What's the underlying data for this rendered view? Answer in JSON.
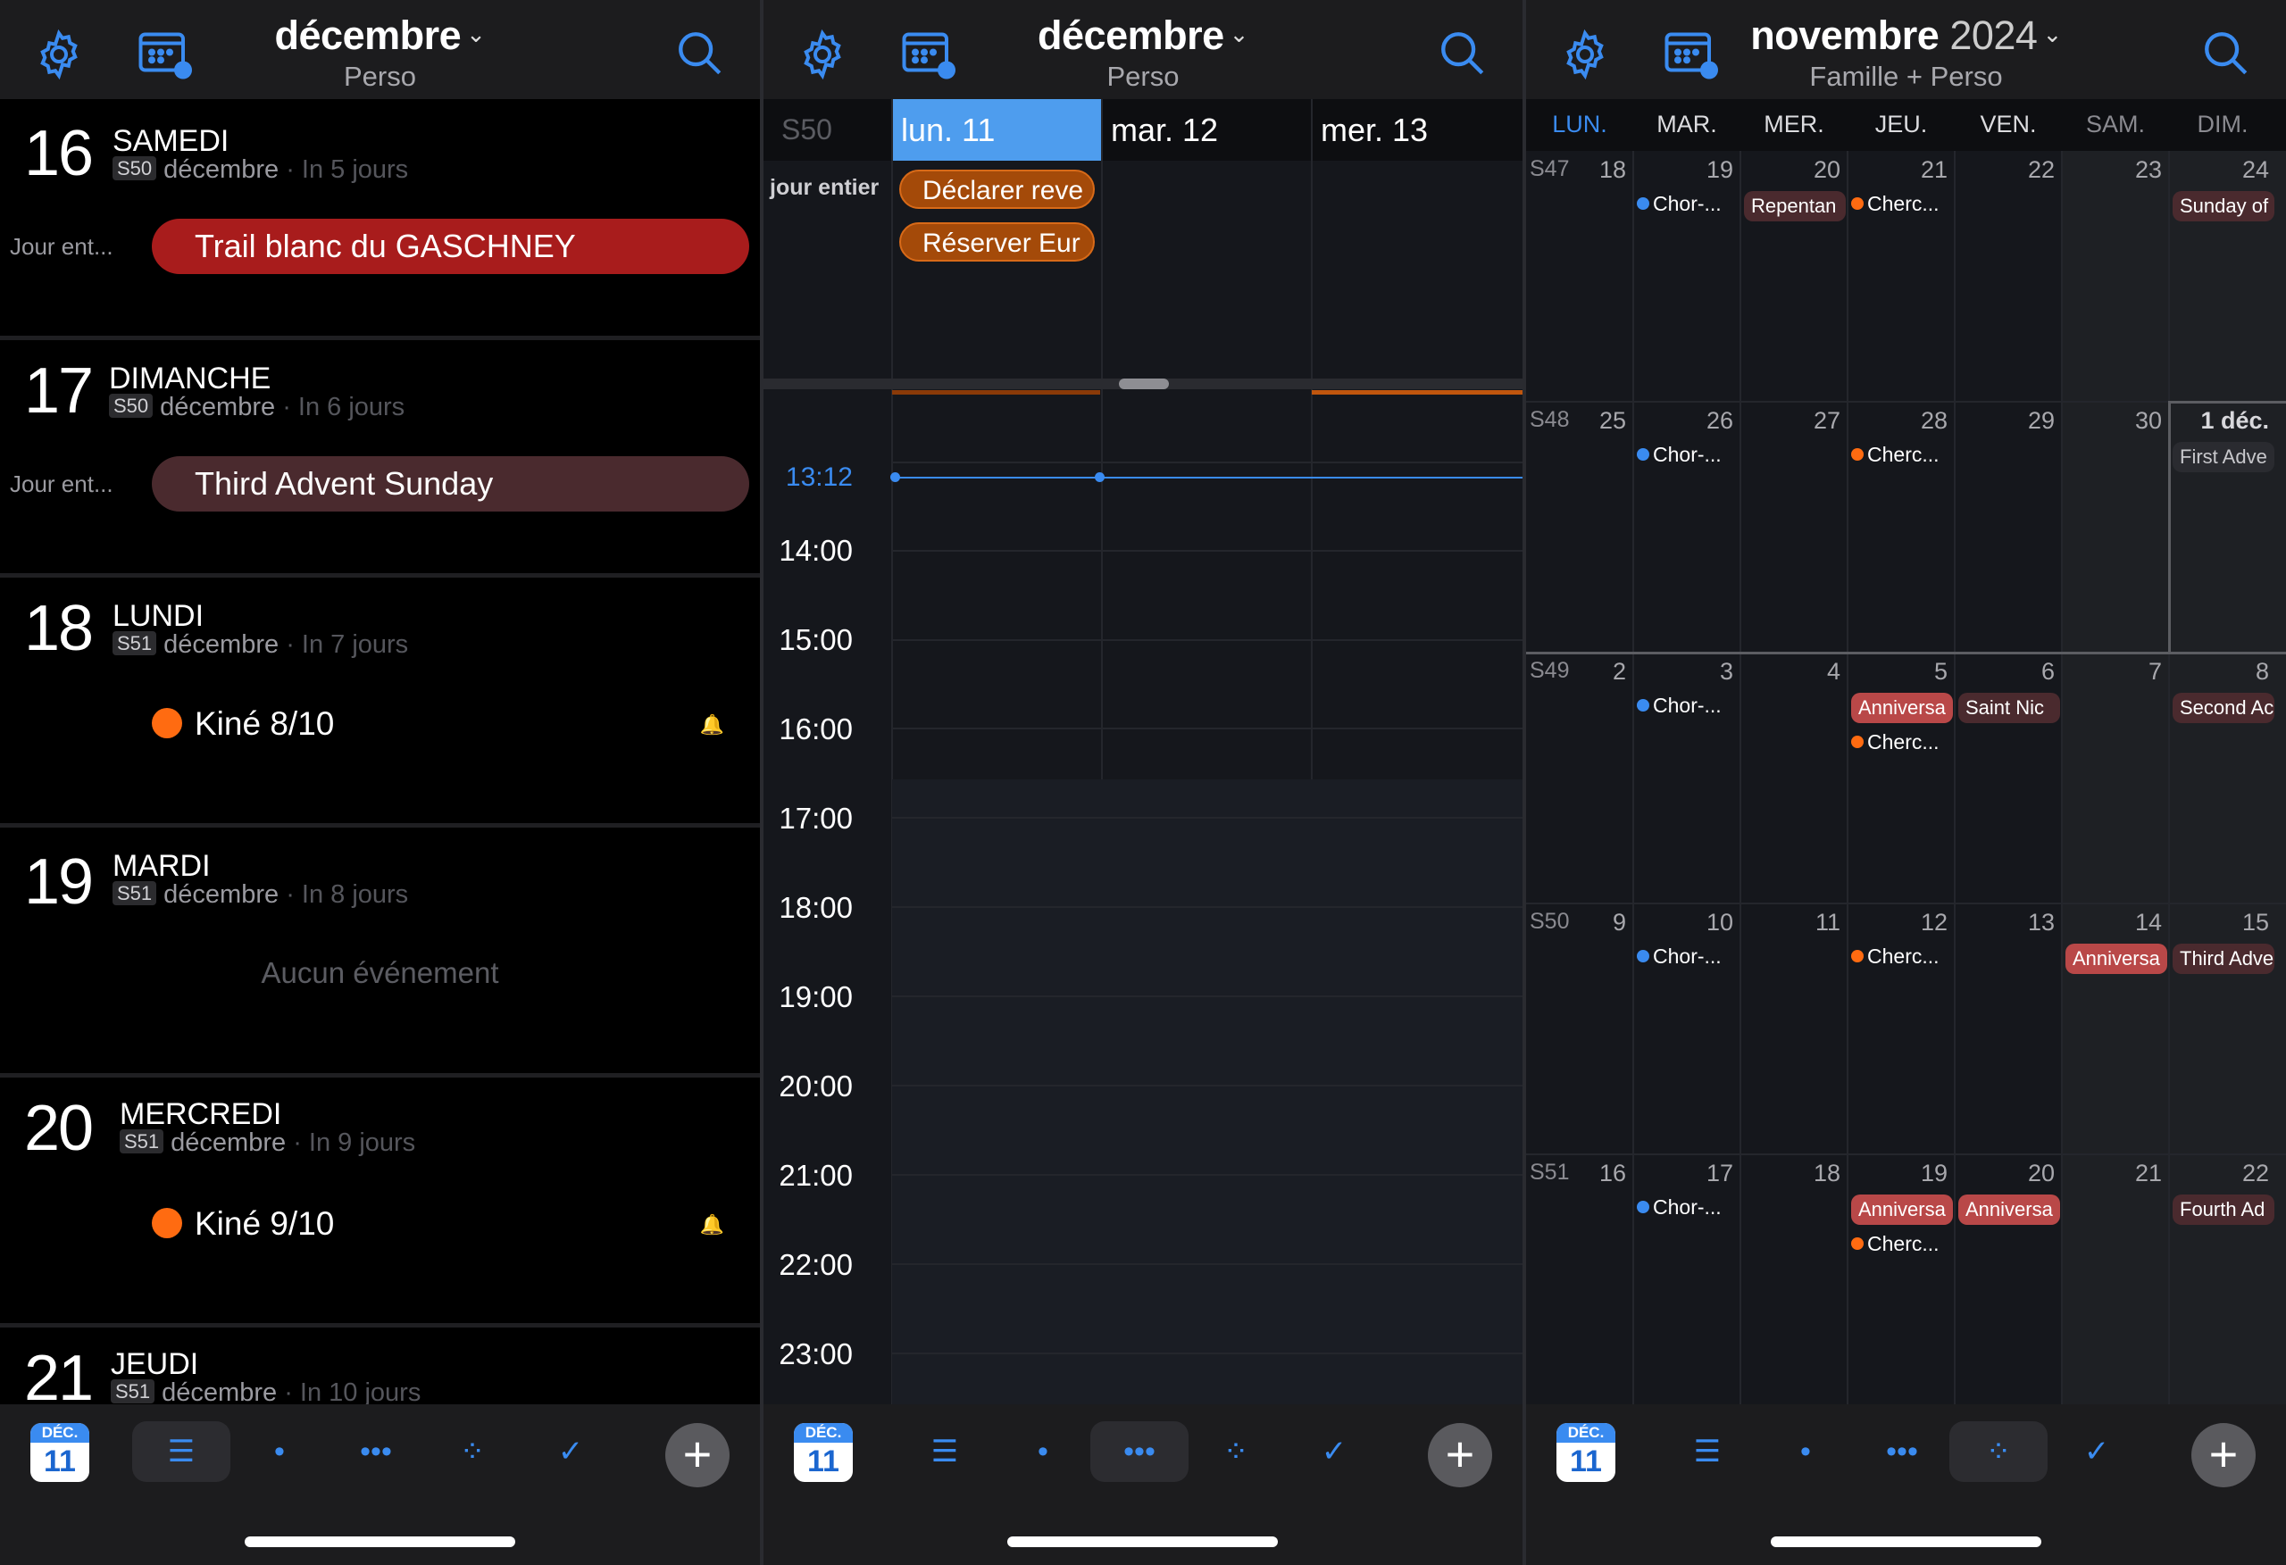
{
  "panel1": {
    "header": {
      "title": "décembre",
      "subtitle": "Perso"
    },
    "days": [
      {
        "num": "16",
        "name": "SAMEDI",
        "week": "S50",
        "month": "décembre",
        "rel": "· In 5 jours",
        "allday_label": "Jour ent...",
        "pill": "Trail blanc du GASCHNEY"
      },
      {
        "num": "17",
        "name": "DIMANCHE",
        "week": "S50",
        "month": "décembre",
        "rel": "· In 6 jours",
        "allday_label": "Jour ent...",
        "pill": "Third Advent Sunday"
      },
      {
        "num": "18",
        "name": "LUNDI",
        "week": "S51",
        "month": "décembre",
        "rel": "· In 7 jours",
        "event": "Kiné 8/10"
      },
      {
        "num": "19",
        "name": "MARDI",
        "week": "S51",
        "month": "décembre",
        "rel": "· In 8 jours",
        "empty": "Aucun événement"
      },
      {
        "num": "20",
        "name": "MERCREDI",
        "week": "S51",
        "month": "décembre",
        "rel": "· In 9 jours",
        "event": "Kiné 9/10"
      },
      {
        "num": "21",
        "name": "JEUDI",
        "week": "S51",
        "month": "décembre",
        "rel": "· In 10 jours"
      }
    ]
  },
  "panel2": {
    "header": {
      "title": "décembre",
      "subtitle": "Perso"
    },
    "week_label": "S50",
    "days": [
      "lun. 11",
      "mar. 12",
      "mer. 13"
    ],
    "allday_label": "jour entier",
    "allday_events": [
      "Déclarer reve",
      "Réserver Eur"
    ],
    "now_time": "13:12",
    "hours": [
      "14:00",
      "15:00",
      "16:00",
      "17:00",
      "18:00",
      "19:00",
      "20:00",
      "21:00",
      "22:00",
      "23:00"
    ]
  },
  "panel3": {
    "header": {
      "title": "novembre",
      "year": "2024",
      "subtitle": "Famille + Perso"
    },
    "weekdays": [
      "LUN.",
      "MAR.",
      "MER.",
      "JEU.",
      "VEN.",
      "SAM.",
      "DIM."
    ],
    "weeks": [
      {
        "wk": "S47",
        "days": [
          "18",
          "19",
          "20",
          "21",
          "22",
          "23",
          "24"
        ]
      },
      {
        "wk": "S48",
        "days": [
          "25",
          "26",
          "27",
          "28",
          "29",
          "30",
          "1 déc."
        ]
      },
      {
        "wk": "S49",
        "days": [
          "2",
          "3",
          "4",
          "5",
          "6",
          "7",
          "8"
        ]
      },
      {
        "wk": "S50",
        "days": [
          "9",
          "10",
          "11",
          "12",
          "13",
          "14",
          "15"
        ]
      },
      {
        "wk": "S51",
        "days": [
          "16",
          "17",
          "18",
          "19",
          "20",
          "21",
          "22"
        ]
      }
    ],
    "events": {
      "chor": "Chor-...",
      "cherc": "Cherc...",
      "repentance": "Repentan",
      "sunday_of": "Sunday of",
      "first_advent": "First Adve",
      "anniv": "Anniversa",
      "saint_nic": "Saint Nic",
      "second_adv": "Second Ac",
      "third_adv": "Third Adve",
      "fourth_adv": "Fourth Ad"
    }
  },
  "bottom_bar": {
    "today_month": "DÉC.",
    "today_day": "11"
  },
  "colors": {
    "accent": "#3a8bf0",
    "orange": "#ff6b11",
    "red_event": "#a81c1c",
    "maroon_event": "#4a2a2e"
  }
}
